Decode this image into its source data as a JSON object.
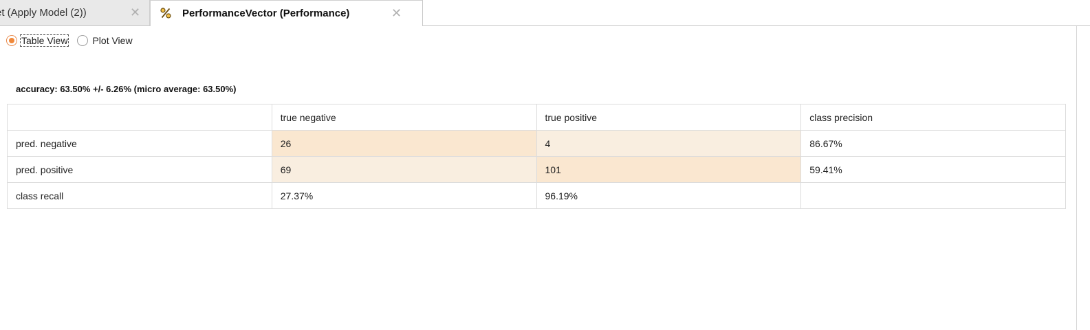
{
  "tabs": [
    {
      "label": "et (Apply Model (2))",
      "active": false,
      "close": "✕"
    },
    {
      "label": "PerformanceVector (Performance)",
      "active": true,
      "icon": "percent-icon",
      "close": "✕"
    }
  ],
  "view_toggle": {
    "table_view": "Table View",
    "plot_view": "Plot View",
    "selected": "Table View"
  },
  "accuracy": "accuracy: 63.50% +/- 6.26% (micro average: 63.50%)",
  "table": {
    "headers": [
      "",
      "true negative",
      "true positive",
      "class precision"
    ],
    "rows": [
      [
        "pred. negative",
        "26",
        "4",
        "86.67%"
      ],
      [
        "pred. positive",
        "69",
        "101",
        "59.41%"
      ],
      [
        "class recall",
        "27.37%",
        "96.19%",
        ""
      ]
    ]
  },
  "colors": {
    "accent": "#f0883a",
    "cell_high": "#fae7d0",
    "cell_low": "#f9eee0"
  }
}
